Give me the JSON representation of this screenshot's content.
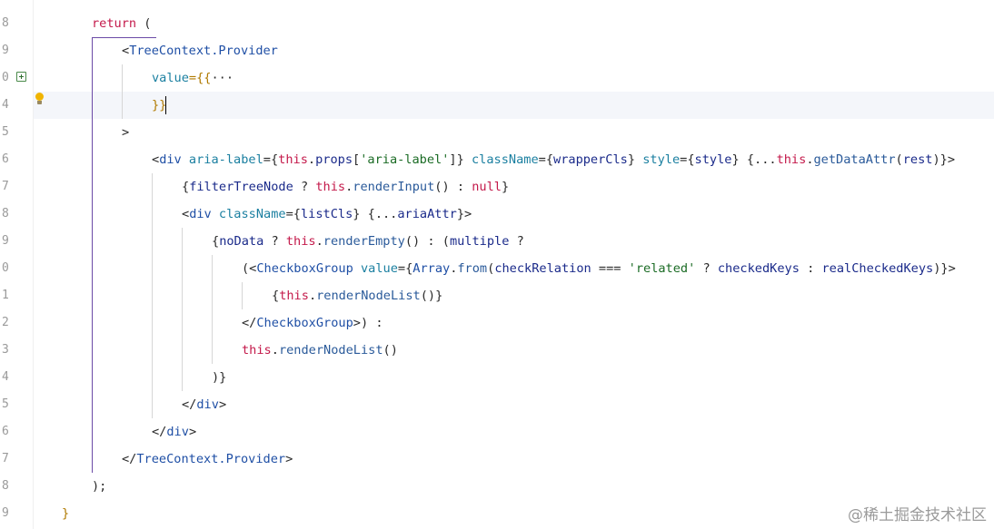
{
  "editor": {
    "line_numbers": [
      "8",
      "9",
      "0",
      "4",
      "5",
      "6",
      "7",
      "8",
      "9",
      "0",
      "1",
      "2",
      "3",
      "4",
      "5",
      "6",
      "7",
      "8",
      "9"
    ],
    "colors": {
      "keyword": "#c41a4b",
      "component": "#1f4fa5",
      "attribute": "#1a7fa0",
      "plain": "#2a2a2a",
      "string": "#1a6b24",
      "property": "#1a2a8a",
      "method": "#2a5a9a",
      "brace": "#b07a00",
      "indent_guide": "#d6d6d6",
      "active_scope": "#6b4aa6"
    },
    "lines": [
      [
        {
          "t": "return",
          "c": "keyword"
        },
        {
          "t": " (",
          "c": "plain"
        }
      ],
      [
        {
          "t": "<",
          "c": "plain"
        },
        {
          "t": "TreeContext.Provider",
          "c": "component"
        }
      ],
      [
        {
          "t": "value",
          "c": "attribute"
        },
        {
          "t": "={{",
          "c": "brace"
        },
        {
          "t": "···",
          "c": "plain"
        }
      ],
      [
        {
          "t": "}}",
          "c": "brace"
        }
      ],
      [
        {
          "t": ">",
          "c": "plain"
        }
      ],
      [
        {
          "t": "<",
          "c": "plain"
        },
        {
          "t": "div",
          "c": "component"
        },
        {
          "t": " aria-label",
          "c": "attribute"
        },
        {
          "t": "={",
          "c": "plain"
        },
        {
          "t": "this",
          "c": "keyword"
        },
        {
          "t": ".",
          "c": "plain"
        },
        {
          "t": "props",
          "c": "property"
        },
        {
          "t": "[",
          "c": "plain"
        },
        {
          "t": "'aria-label'",
          "c": "string"
        },
        {
          "t": "]}",
          "c": "plain"
        },
        {
          "t": " className",
          "c": "attribute"
        },
        {
          "t": "={",
          "c": "plain"
        },
        {
          "t": "wrapperCls",
          "c": "property"
        },
        {
          "t": "}",
          "c": "plain"
        },
        {
          "t": " style",
          "c": "attribute"
        },
        {
          "t": "={",
          "c": "plain"
        },
        {
          "t": "style",
          "c": "property"
        },
        {
          "t": "} {...",
          "c": "plain"
        },
        {
          "t": "this",
          "c": "keyword"
        },
        {
          "t": ".",
          "c": "plain"
        },
        {
          "t": "getDataAttr",
          "c": "method"
        },
        {
          "t": "(",
          "c": "plain"
        },
        {
          "t": "rest",
          "c": "property"
        },
        {
          "t": ")}>",
          "c": "plain"
        }
      ],
      [
        {
          "t": "{",
          "c": "plain"
        },
        {
          "t": "filterTreeNode",
          "c": "property"
        },
        {
          "t": " ? ",
          "c": "plain"
        },
        {
          "t": "this",
          "c": "keyword"
        },
        {
          "t": ".",
          "c": "plain"
        },
        {
          "t": "renderInput",
          "c": "method"
        },
        {
          "t": "() : ",
          "c": "plain"
        },
        {
          "t": "null",
          "c": "keyword"
        },
        {
          "t": "}",
          "c": "plain"
        }
      ],
      [
        {
          "t": "<",
          "c": "plain"
        },
        {
          "t": "div",
          "c": "component"
        },
        {
          "t": " className",
          "c": "attribute"
        },
        {
          "t": "={",
          "c": "plain"
        },
        {
          "t": "listCls",
          "c": "property"
        },
        {
          "t": "} {...",
          "c": "plain"
        },
        {
          "t": "ariaAttr",
          "c": "property"
        },
        {
          "t": "}>",
          "c": "plain"
        }
      ],
      [
        {
          "t": "{",
          "c": "plain"
        },
        {
          "t": "noData",
          "c": "property"
        },
        {
          "t": " ? ",
          "c": "plain"
        },
        {
          "t": "this",
          "c": "keyword"
        },
        {
          "t": ".",
          "c": "plain"
        },
        {
          "t": "renderEmpty",
          "c": "method"
        },
        {
          "t": "() : (",
          "c": "plain"
        },
        {
          "t": "multiple",
          "c": "property"
        },
        {
          "t": " ?",
          "c": "plain"
        }
      ],
      [
        {
          "t": "(<",
          "c": "plain"
        },
        {
          "t": "CheckboxGroup",
          "c": "component"
        },
        {
          "t": " value",
          "c": "attribute"
        },
        {
          "t": "={",
          "c": "plain"
        },
        {
          "t": "Array",
          "c": "component"
        },
        {
          "t": ".",
          "c": "plain"
        },
        {
          "t": "from",
          "c": "method"
        },
        {
          "t": "(",
          "c": "plain"
        },
        {
          "t": "checkRelation",
          "c": "property"
        },
        {
          "t": " === ",
          "c": "plain"
        },
        {
          "t": "'related'",
          "c": "string"
        },
        {
          "t": " ? ",
          "c": "plain"
        },
        {
          "t": "checkedKeys",
          "c": "property"
        },
        {
          "t": " : ",
          "c": "plain"
        },
        {
          "t": "realCheckedKeys",
          "c": "property"
        },
        {
          "t": ")}>",
          "c": "plain"
        }
      ],
      [
        {
          "t": "{",
          "c": "plain"
        },
        {
          "t": "this",
          "c": "keyword"
        },
        {
          "t": ".",
          "c": "plain"
        },
        {
          "t": "renderNodeList",
          "c": "method"
        },
        {
          "t": "()}",
          "c": "plain"
        }
      ],
      [
        {
          "t": "</",
          "c": "plain"
        },
        {
          "t": "CheckboxGroup",
          "c": "component"
        },
        {
          "t": ">) :",
          "c": "plain"
        }
      ],
      [
        {
          "t": "this",
          "c": "keyword"
        },
        {
          "t": ".",
          "c": "plain"
        },
        {
          "t": "renderNodeList",
          "c": "method"
        },
        {
          "t": "()",
          "c": "plain"
        }
      ],
      [
        {
          "t": ")}",
          "c": "plain"
        }
      ],
      [
        {
          "t": "</",
          "c": "plain"
        },
        {
          "t": "div",
          "c": "component"
        },
        {
          "t": ">",
          "c": "plain"
        }
      ],
      [
        {
          "t": "</",
          "c": "plain"
        },
        {
          "t": "div",
          "c": "component"
        },
        {
          "t": ">",
          "c": "plain"
        }
      ],
      [
        {
          "t": "</",
          "c": "plain"
        },
        {
          "t": "TreeContext.Provider",
          "c": "component"
        },
        {
          "t": ">",
          "c": "plain"
        }
      ],
      [
        {
          "t": ");",
          "c": "plain"
        }
      ],
      [
        {
          "t": "}",
          "c": "brace"
        }
      ]
    ]
  },
  "watermark": "@稀土掘金技术社区"
}
